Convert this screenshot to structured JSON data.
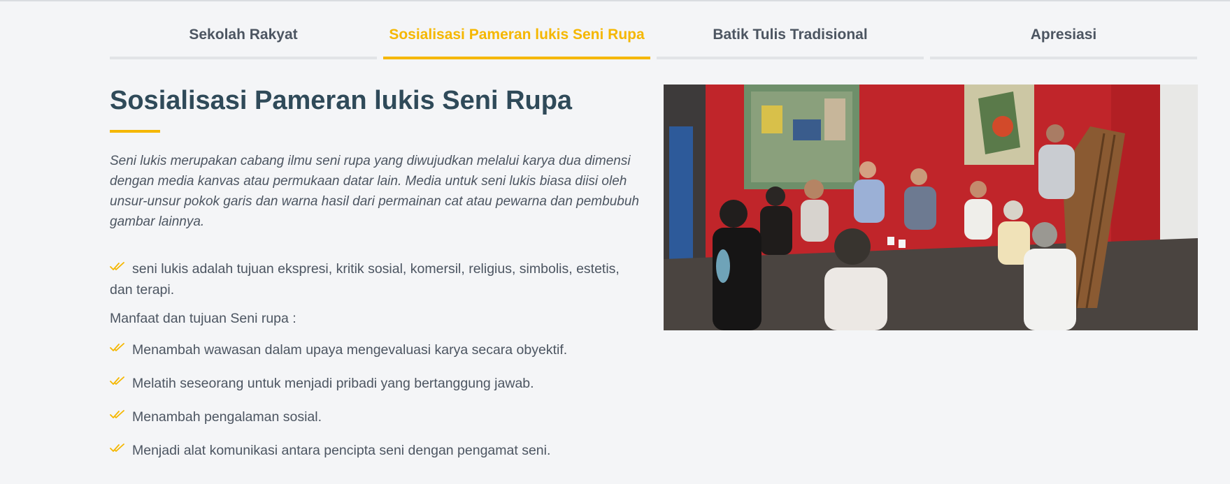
{
  "tabs": [
    {
      "label": "Sekolah Rakyat",
      "active": false
    },
    {
      "label": "Sosialisasi Pameran lukis Seni Rupa",
      "active": true
    },
    {
      "label": "Batik Tulis Tradisional",
      "active": false
    },
    {
      "label": "Apresiasi",
      "active": false
    }
  ],
  "main": {
    "title": "Sosialisasi Pameran lukis Seni Rupa",
    "intro": "Seni lukis merupakan cabang ilmu seni rupa yang diwujudkan melalui karya dua dimensi dengan media kanvas atau permukaan datar lain. Media untuk seni lukis biasa diisi oleh unsur-unsur pokok garis dan warna hasil dari permainan cat atau pewarna dan pembubuh gambar lainnya.",
    "purpose": "seni lukis adalah tujuan ekspresi, kritik sosial, komersil, religius, simbolis, estetis, dan terapi.",
    "benefits_heading": "Manfaat dan tujuan Seni rupa :",
    "benefits": [
      "Menambah wawasan dalam upaya mengevaluasi karya secara obyektif.",
      "Melatih seseorang untuk menjadi pribadi yang bertanggung jawab.",
      "Menambah pengalaman sosial.",
      "Menjadi alat komunikasi antara pencipta seni dengan pengamat seni."
    ]
  },
  "colors": {
    "accent": "#f5b700",
    "heading": "#2f4a59",
    "text": "#4c5561"
  },
  "icons": {
    "bullet": "double-check-icon"
  }
}
